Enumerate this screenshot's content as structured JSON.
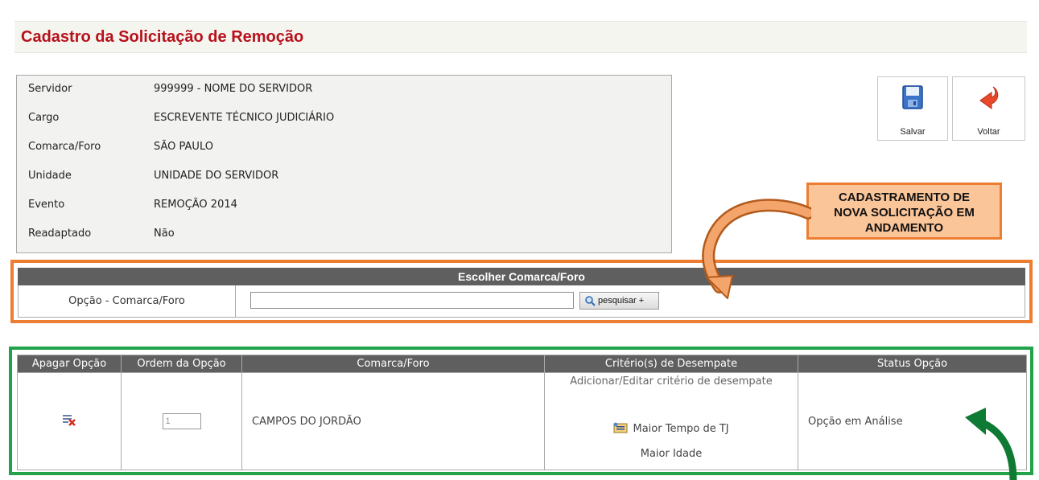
{
  "page": {
    "title": "Cadastro da Solicitação de Remoção"
  },
  "servidor_info": {
    "rows": [
      {
        "label": "Servidor",
        "value": "999999 - NOME DO SERVIDOR"
      },
      {
        "label": "Cargo",
        "value": "ESCREVENTE TÉCNICO JUDICIÁRIO"
      },
      {
        "label": "Comarca/Foro",
        "value": "SÃO PAULO"
      },
      {
        "label": "Unidade",
        "value": "UNIDADE DO SERVIDOR"
      },
      {
        "label": "Evento",
        "value": "REMOÇÃO 2014"
      },
      {
        "label": "Readaptado",
        "value": "Não"
      }
    ]
  },
  "toolbar": {
    "save_label": "Salvar",
    "back_label": "Voltar",
    "save_icon": "floppy-disk-icon",
    "back_icon": "curved-back-arrow-icon"
  },
  "callout": {
    "lines": [
      "CADASTRAMENTO DE",
      "NOVA SOLICITAÇÃO EM",
      "ANDAMENTO"
    ]
  },
  "search": {
    "header": "Escolher Comarca/Foro",
    "field_label": "Opção - Comarca/Foro",
    "input_value": "",
    "button_label": "pesquisar +"
  },
  "options_table": {
    "columns": [
      "Apagar Opção",
      "Ordem da Opção",
      "Comarca/Foro",
      "Critério(s) de Desempate",
      "Status Opção"
    ],
    "rows": [
      {
        "order": "1",
        "comarca": "CAMPOS DO JORDÃO",
        "criteria_link": "Adicionar/Editar critério de desempate",
        "criteria": [
          "Maior Tempo de TJ",
          "Maior Idade"
        ],
        "status": "Opção em Análise"
      }
    ]
  },
  "colors": {
    "title_red": "#b8111c",
    "header_gray": "#5f5f5f",
    "highlight_orange": "#ed7d31",
    "callout_fill": "#fbc59a",
    "highlight_green": "#22a34a",
    "arrow_green": "#0e7a33"
  }
}
